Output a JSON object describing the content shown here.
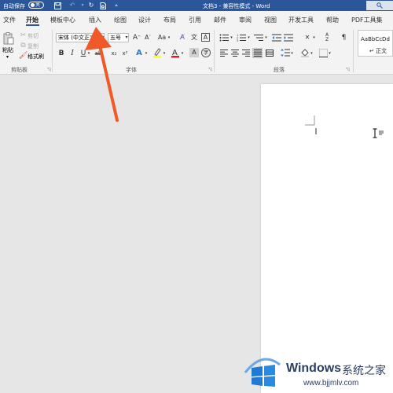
{
  "titlebar": {
    "autosave_label": "自动保存",
    "autosave_state": "关",
    "doc_title": "文档3 - 兼容性模式 - Word"
  },
  "menu": {
    "tabs": [
      "文件",
      "开始",
      "模板中心",
      "插入",
      "绘图",
      "设计",
      "布局",
      "引用",
      "邮件",
      "审阅",
      "视图",
      "开发工具",
      "帮助",
      "PDF工具集"
    ],
    "active_tab": "开始"
  },
  "ribbon": {
    "clipboard": {
      "paste": "粘贴",
      "cut": "剪切",
      "copy": "复制",
      "format_painter": "格式刷",
      "group_label": "剪贴板"
    },
    "font": {
      "font_name": "宋体 (中文正文)",
      "font_size": "五号",
      "grow": "A",
      "shrink": "A",
      "case": "Aa",
      "bold": "B",
      "italic": "I",
      "underline": "U",
      "strike": "ab",
      "subscript": "x₂",
      "superscript": "x²",
      "text_effect": "A",
      "highlight": "ab",
      "font_color": "A",
      "char_shading": "A",
      "enclose": "字",
      "group_label": "字体"
    },
    "paragraph": {
      "group_label": "段落"
    },
    "styles": {
      "sample": "AaBbCcDd",
      "name": "↵ 正文"
    }
  },
  "colors": {
    "accent": "#2b579a",
    "arrow": "#f05a28"
  }
}
